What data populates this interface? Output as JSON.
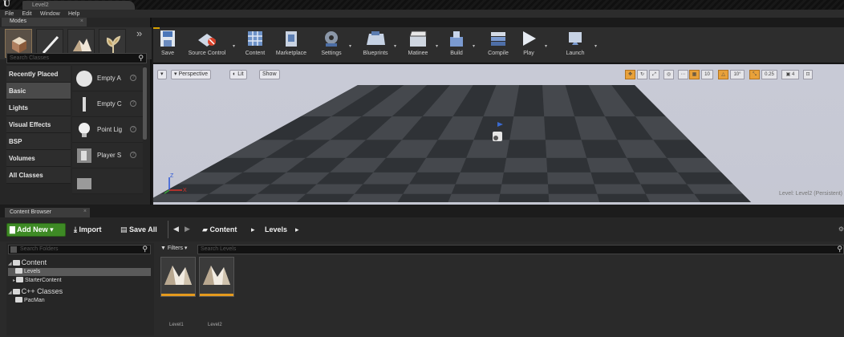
{
  "app": {
    "tab_title": "Level2"
  },
  "menu": [
    "File",
    "Edit",
    "Window",
    "Help"
  ],
  "modes": {
    "tab_label": "Modes",
    "search_placeholder": "Search Classes",
    "categories": [
      "Recently Placed",
      "Basic",
      "Lights",
      "Visual Effects",
      "BSP",
      "Volumes",
      "All Classes"
    ],
    "active_category": "Basic",
    "items": [
      "Empty A",
      "Empty C",
      "Point Lig",
      "Player S"
    ]
  },
  "toolbar": {
    "buttons": [
      "Save",
      "Source Control",
      "Content",
      "Marketplace",
      "Settings",
      "Blueprints",
      "Matinee",
      "Build",
      "Compile",
      "Play",
      "Launch"
    ]
  },
  "viewport": {
    "view_mode": "Perspective",
    "lighting": "Lit",
    "show": "Show",
    "grid_snap": "10",
    "rot_snap": "10°",
    "scale_snap": "0.25",
    "camera_speed": "4",
    "level_label": "Level:  Level2 (Persistent)",
    "sky_color": "#c8cad6",
    "floor_color": "#3a3d42",
    "accent_color": "#e8a13a"
  },
  "content_browser": {
    "tab_label": "Content Browser",
    "add_new": "Add New",
    "import": "Import",
    "save_all": "Save All",
    "breadcrumb": [
      "Content",
      "Levels"
    ],
    "folder_search_placeholder": "Search Folders",
    "filters_label": "Filters",
    "asset_search_placeholder": "Search Levels",
    "tree": {
      "content": "Content",
      "levels": "Levels",
      "starter": "StarterContent",
      "cpp": "C++ Classes",
      "pacman": "PacMan"
    },
    "assets": [
      "Level1",
      "Level2"
    ]
  }
}
